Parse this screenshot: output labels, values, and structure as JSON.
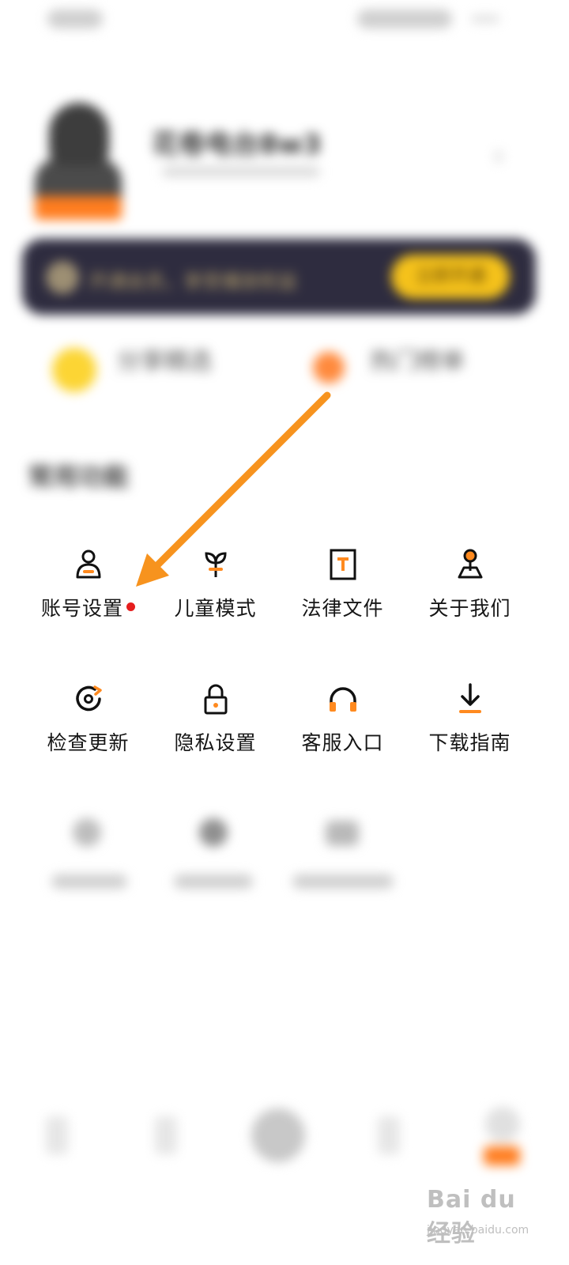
{
  "profile": {
    "name": "花卷电台8w3"
  },
  "vip_banner": {
    "text": "开通会员，享受播放权益",
    "button": "立即开通"
  },
  "shortcuts": [
    {
      "label": "分享精选",
      "icon": "sun-icon",
      "color": "#fcd534"
    },
    {
      "label": "热门榜单",
      "icon": "fire-icon",
      "color": "#ff8a3d"
    }
  ],
  "section_title": "常用功能",
  "functions": [
    {
      "label": "账号设置",
      "icon": "user-icon",
      "badge": "red-dot"
    },
    {
      "label": "儿童模式",
      "icon": "sprout-icon"
    },
    {
      "label": "法律文件",
      "icon": "document-icon"
    },
    {
      "label": "关于我们",
      "icon": "location-pin-icon"
    },
    {
      "label": "检查更新",
      "icon": "refresh-icon"
    },
    {
      "label": "隐私设置",
      "icon": "lock-icon"
    },
    {
      "label": "客服入口",
      "icon": "headphones-icon"
    },
    {
      "label": "下载指南",
      "icon": "download-icon"
    }
  ],
  "watermark": {
    "brand": "Bai du经验",
    "site": "jingyan.baidu.com"
  },
  "colors": {
    "accent": "#ff8a1f",
    "banner_bg": "#2e2c3f",
    "vip_button": "#f5c21b",
    "badge": "#e61e1e"
  }
}
